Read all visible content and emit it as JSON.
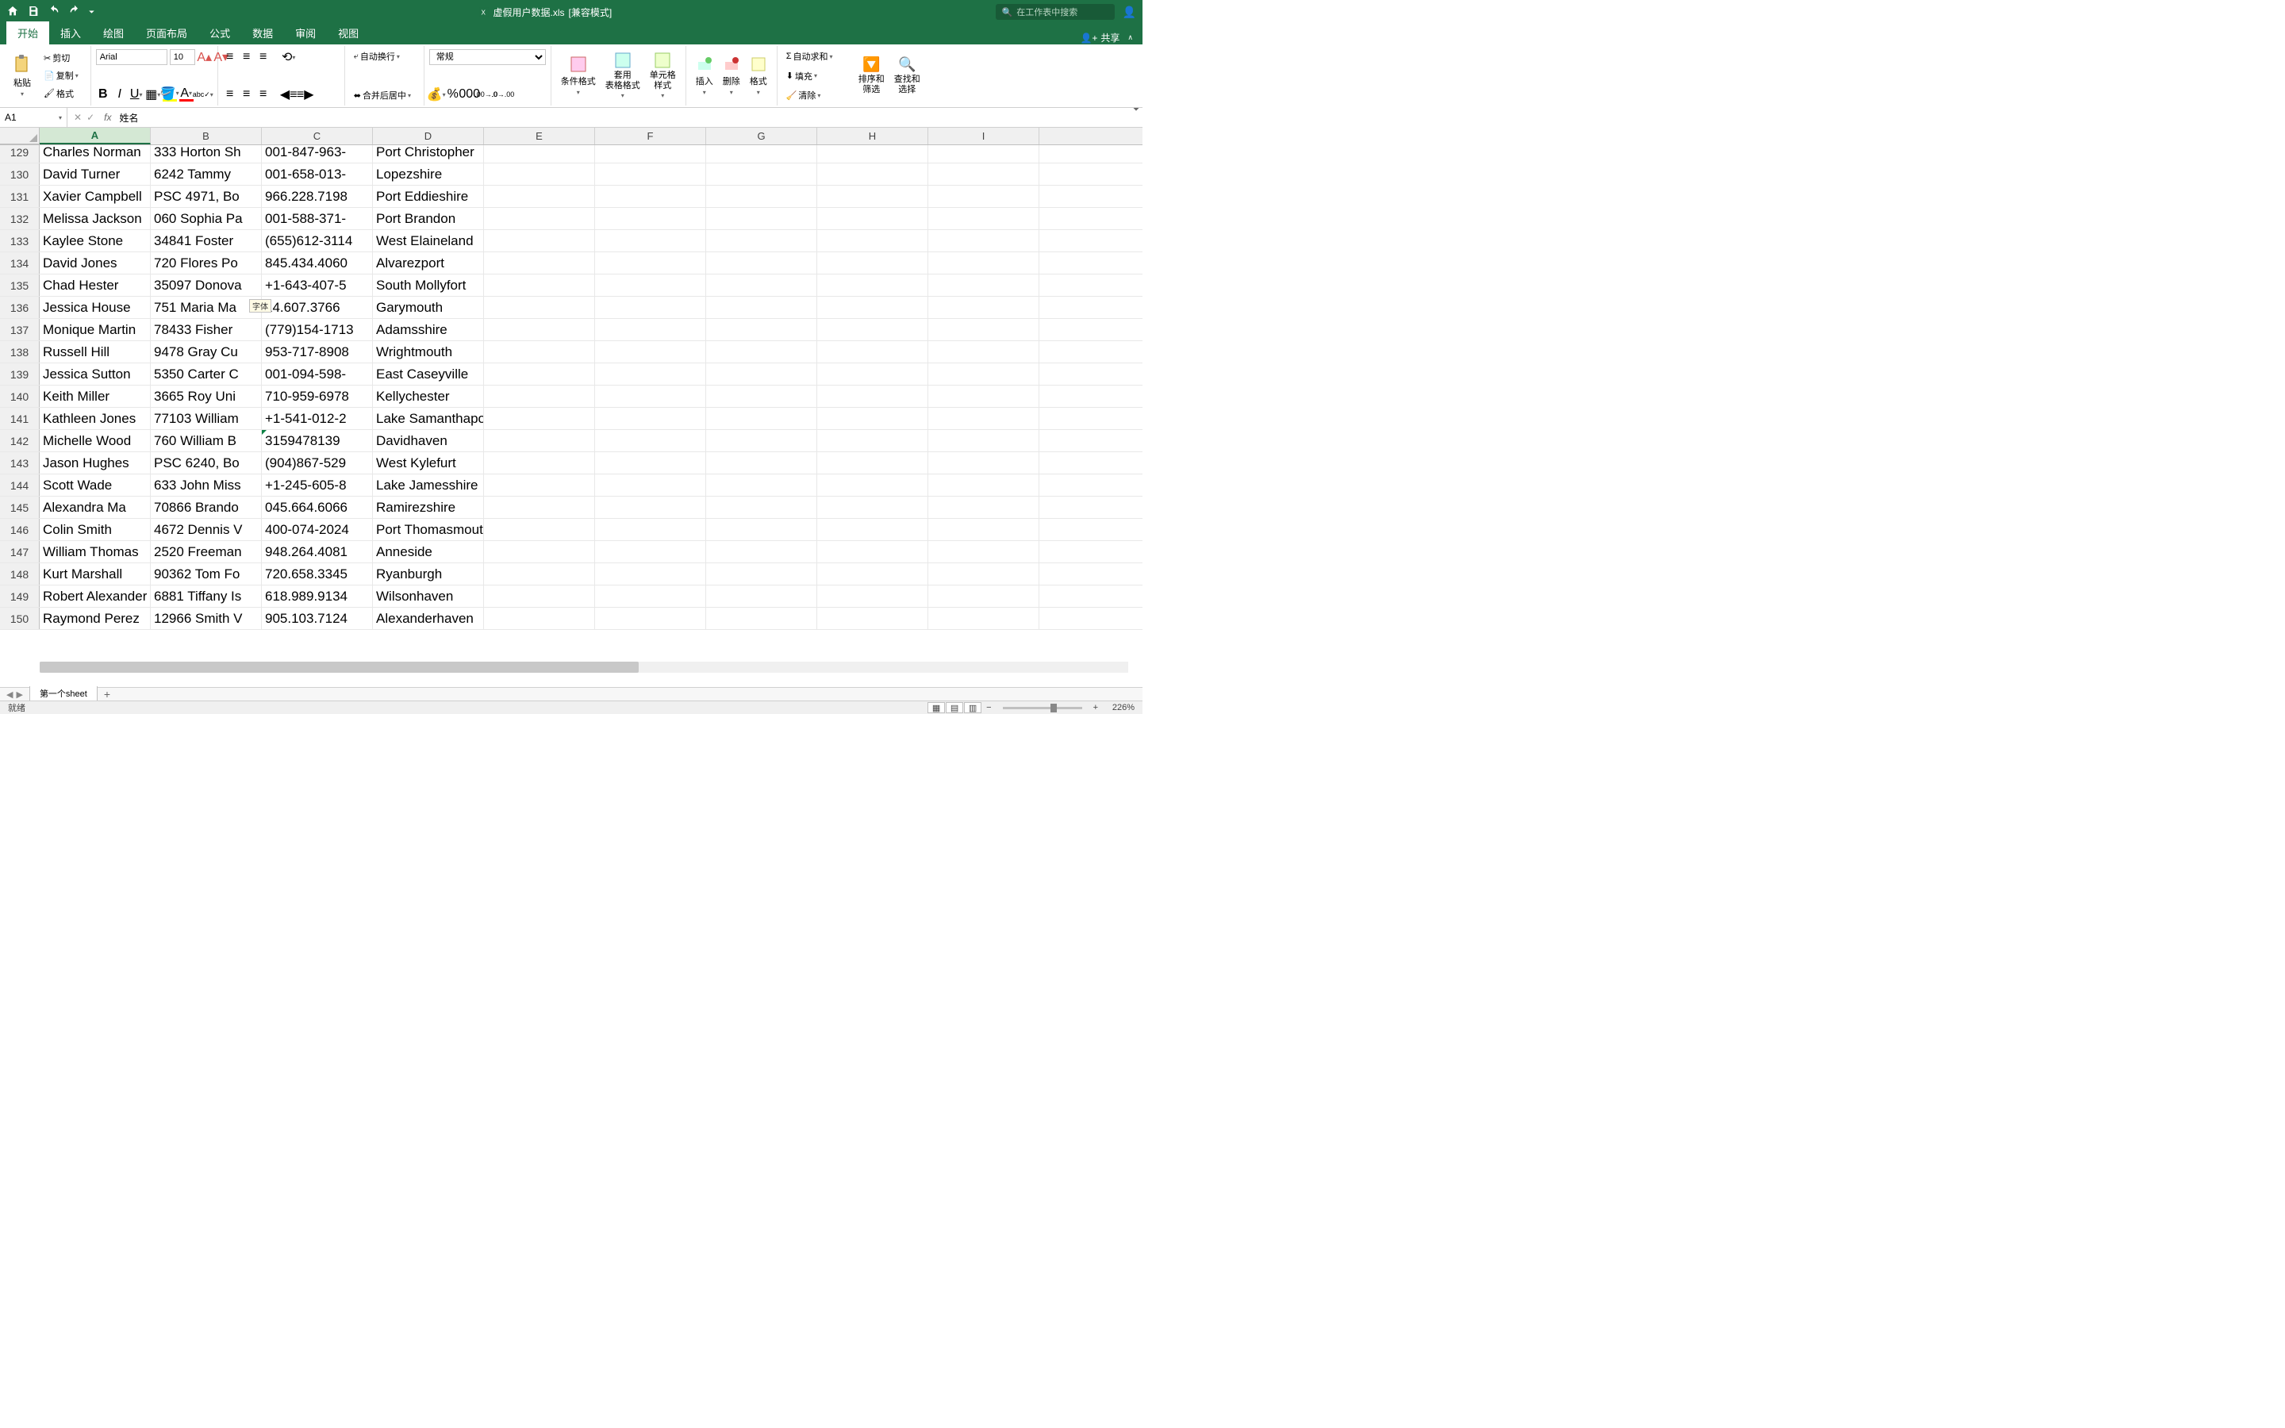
{
  "app": {
    "filename": "虚假用户数据.xls",
    "mode": "[兼容模式]",
    "search_placeholder": "在工作表中搜索"
  },
  "menu_tabs": [
    "开始",
    "插入",
    "绘图",
    "页面布局",
    "公式",
    "数据",
    "审阅",
    "视图"
  ],
  "share_label": "共享",
  "ribbon": {
    "paste": "粘贴",
    "cut": "剪切",
    "copy": "复制",
    "format_painter": "格式",
    "font_name": "Arial",
    "font_size": "10",
    "wrap_text": "自动换行",
    "merge_center": "合并后居中",
    "number_format": "常规",
    "cond_format": "条件格式",
    "table_format": "套用\n表格格式",
    "cell_styles": "单元格\n样式",
    "insert": "插入",
    "delete": "删除",
    "format": "格式",
    "autosum": "自动求和",
    "fill": "填充",
    "clear": "清除",
    "sort_filter": "排序和\n筛选",
    "find_select": "查找和\n选择",
    "tooltip_font": "字体"
  },
  "namebox": "A1",
  "formula": "姓名",
  "columns": [
    "A",
    "B",
    "C",
    "D",
    "E",
    "F",
    "G",
    "H",
    "I"
  ],
  "active_col": "A",
  "rows": [
    {
      "n": 129,
      "a": "Charles Norman",
      "b": "333 Horton Sh",
      "c": "001-847-963-",
      "d": "Port Christopher"
    },
    {
      "n": 130,
      "a": "David Turner",
      "b": "6242 Tammy",
      "c": "001-658-013-",
      "d": "Lopezshire"
    },
    {
      "n": 131,
      "a": "Xavier Campbell",
      "b": "PSC 4971, Bo",
      "c": "966.228.7198",
      "d": "Port Eddieshire"
    },
    {
      "n": 132,
      "a": "Melissa Jackson",
      "b": "060 Sophia Pa",
      "c": "001-588-371-",
      "d": "Port Brandon"
    },
    {
      "n": 133,
      "a": "Kaylee Stone",
      "b": "34841 Foster",
      "c": "(655)612-3114",
      "d": "West Elaineland"
    },
    {
      "n": 134,
      "a": "David Jones",
      "b": "720 Flores Po",
      "c": "845.434.4060",
      "d": "Alvarezport"
    },
    {
      "n": 135,
      "a": "Chad Hester",
      "b": "35097 Donova",
      "c": "+1-643-407-5",
      "d": "South Mollyfort"
    },
    {
      "n": 136,
      "a": "Jessica House",
      "b": "751 Maria Ma",
      "c": "14.607.3766",
      "d": "Garymouth"
    },
    {
      "n": 137,
      "a": "Monique Martin",
      "b": "78433 Fisher",
      "c": "(779)154-1713",
      "d": "Adamsshire"
    },
    {
      "n": 138,
      "a": "Russell Hill",
      "b": "9478 Gray Cu",
      "c": "953-717-8908",
      "d": "Wrightmouth"
    },
    {
      "n": 139,
      "a": "Jessica Sutton",
      "b": "5350 Carter C",
      "c": "001-094-598-",
      "d": "East Caseyville"
    },
    {
      "n": 140,
      "a": "Keith Miller",
      "b": "3665 Roy Uni",
      "c": "710-959-6978",
      "d": "Kellychester"
    },
    {
      "n": 141,
      "a": "Kathleen Jones",
      "b": "77103 William",
      "c": "+1-541-012-2",
      "d": "Lake Samanthaport"
    },
    {
      "n": 142,
      "a": "Michelle Wood",
      "b": "760 William B",
      "c": "3159478139",
      "d": "Davidhaven",
      "tri": true
    },
    {
      "n": 143,
      "a": "Jason Hughes",
      "b": "PSC 6240, Bo",
      "c": "(904)867-529",
      "d": "West Kylefurt"
    },
    {
      "n": 144,
      "a": "Scott Wade",
      "b": "633 John Miss",
      "c": "+1-245-605-8",
      "d": "Lake Jamesshire"
    },
    {
      "n": 145,
      "a": "Alexandra Ma",
      "b": "70866 Brando",
      "c": "045.664.6066",
      "d": "Ramirezshire"
    },
    {
      "n": 146,
      "a": "Colin Smith",
      "b": "4672 Dennis V",
      "c": "400-074-2024",
      "d": "Port Thomasmouth"
    },
    {
      "n": 147,
      "a": "William Thomas",
      "b": "2520 Freeman",
      "c": "948.264.4081",
      "d": "Anneside"
    },
    {
      "n": 148,
      "a": "Kurt Marshall",
      "b": "90362 Tom Fo",
      "c": "720.658.3345",
      "d": "Ryanburgh"
    },
    {
      "n": 149,
      "a": "Robert Alexander",
      "b": "6881 Tiffany Is",
      "c": "618.989.9134",
      "d": "Wilsonhaven"
    },
    {
      "n": 150,
      "a": "Raymond Perez",
      "b": "12966 Smith V",
      "c": "905.103.7124",
      "d": "Alexanderhaven"
    }
  ],
  "sheet_tab": "第一个sheet",
  "status": "就绪",
  "zoom": "226%"
}
